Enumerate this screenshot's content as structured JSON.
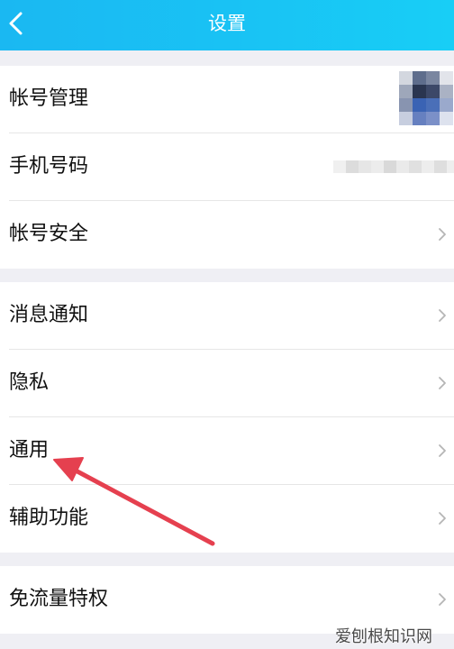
{
  "header": {
    "title": "设置",
    "back_icon": "chevron-left-icon",
    "background": "#19c3f4"
  },
  "groups": [
    {
      "items": [
        {
          "label": "帐号管理",
          "accessory": "avatar"
        },
        {
          "label": "手机号码",
          "accessory": "masked-phone"
        },
        {
          "label": "帐号安全",
          "accessory": "chevron-right-icon"
        }
      ]
    },
    {
      "items": [
        {
          "label": "消息通知",
          "accessory": "chevron-right-icon"
        },
        {
          "label": "隐私",
          "accessory": "chevron-right-icon"
        },
        {
          "label": "通用",
          "accessory": "chevron-right-icon"
        },
        {
          "label": "辅助功能",
          "accessory": "chevron-right-icon"
        }
      ]
    },
    {
      "items": [
        {
          "label": "免流量特权",
          "accessory": "chevron-right-icon"
        }
      ]
    }
  ],
  "annotation": {
    "arrow_color": "#e5404f",
    "points_to": "通用"
  },
  "watermark": {
    "text": "爱刨根知识网"
  },
  "colors": {
    "page_background": "#efeff4",
    "row_background": "#ffffff",
    "separator": "#e6e6e6",
    "chevron": "#b5b5b5"
  }
}
